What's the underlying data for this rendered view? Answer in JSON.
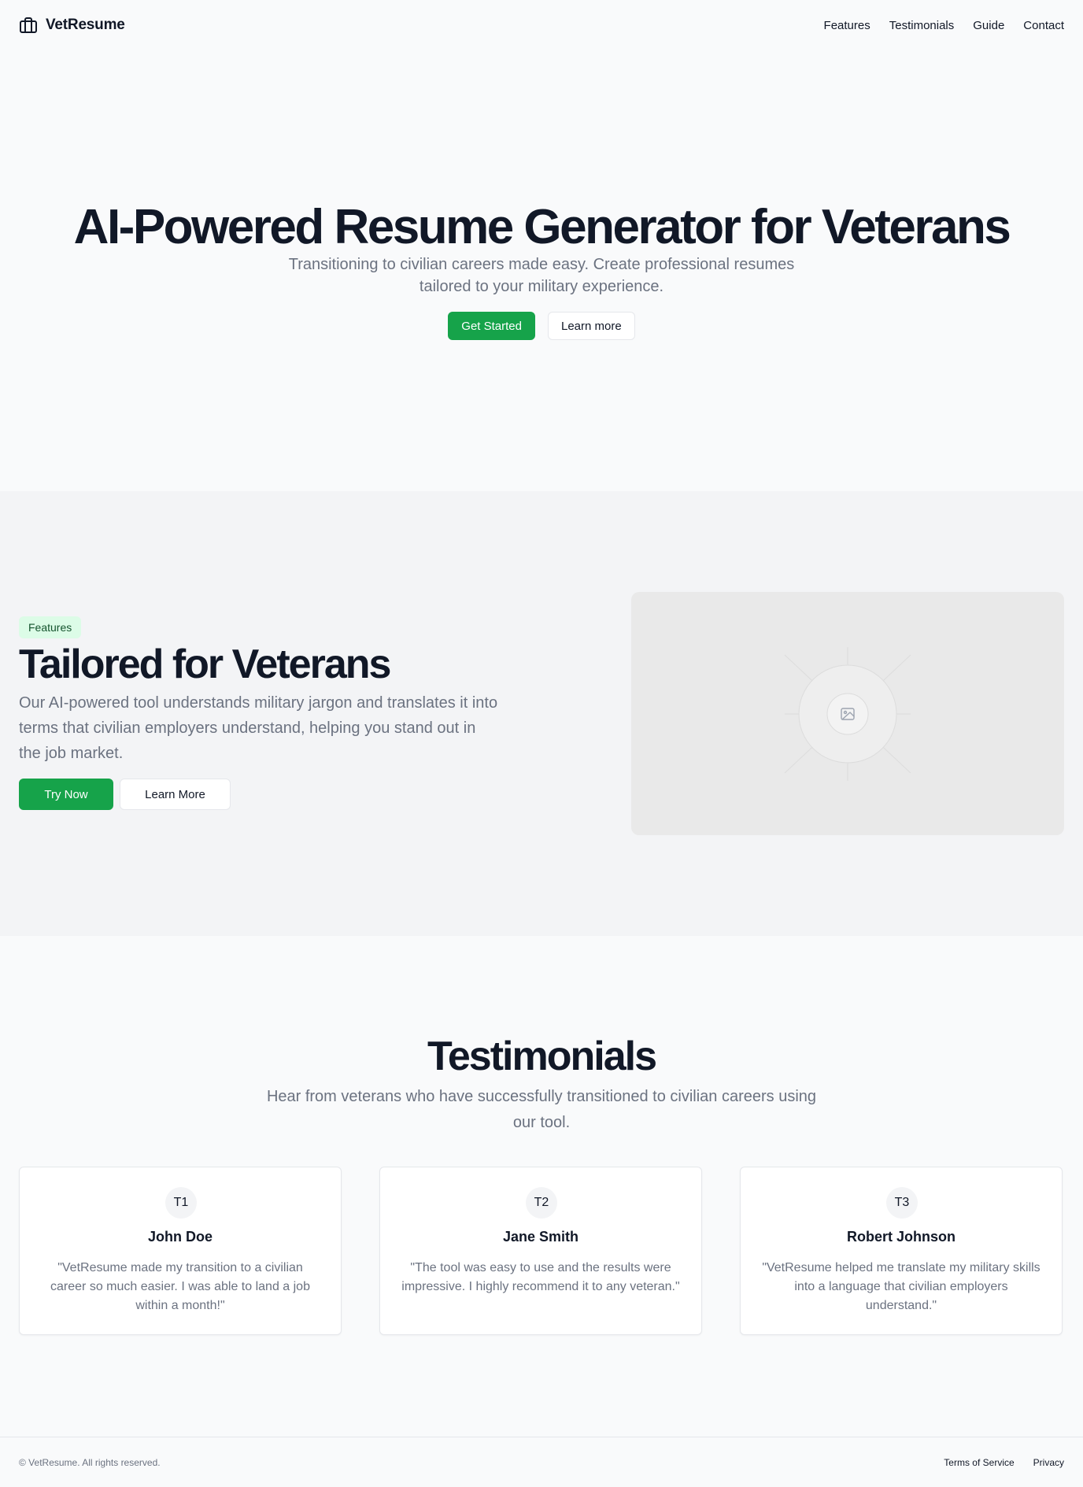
{
  "header": {
    "brand_icon": "briefcase-icon",
    "brand_name": "VetResume",
    "nav": [
      {
        "label": "Features"
      },
      {
        "label": "Testimonials"
      },
      {
        "label": "Guide"
      },
      {
        "label": "Contact"
      }
    ]
  },
  "hero": {
    "title": "AI-Powered Resume Generator for Veterans",
    "subtitle": "Transitioning to civilian careers made easy. Create professional resumes tailored to your military experience.",
    "primary_button": "Get Started",
    "secondary_button": "Learn more"
  },
  "features": {
    "badge": "Features",
    "title": "Tailored for Veterans",
    "text": "Our AI-powered tool understands military jargon and translates it into terms that civilian employers understand, helping you stand out in the job market.",
    "primary_button": "Try Now",
    "secondary_button": "Learn More",
    "image_icon": "image-placeholder-icon"
  },
  "testimonials": {
    "title": "Testimonials",
    "subtitle": "Hear from veterans who have successfully transitioned to civilian careers using our tool.",
    "items": [
      {
        "initials": "T1",
        "name": "John Doe",
        "quote": "\"VetResume made my transition to a civilian career so much easier. I was able to land a job within a month!\""
      },
      {
        "initials": "T2",
        "name": "Jane Smith",
        "quote": "\"The tool was easy to use and the results were impressive. I highly recommend it to any veteran.\""
      },
      {
        "initials": "T3",
        "name": "Robert Johnson",
        "quote": "\"VetResume helped me translate my military skills into a language that civilian employers understand.\""
      }
    ]
  },
  "footer": {
    "copyright": "© VetResume. All rights reserved.",
    "links": [
      {
        "label": "Terms of Service"
      },
      {
        "label": "Privacy"
      }
    ]
  },
  "colors": {
    "accent": "#16a34a",
    "badge_bg": "#dcfce7",
    "page_bg": "#f9fafb",
    "section_bg": "#f3f4f6",
    "muted_text": "#6b7280"
  }
}
